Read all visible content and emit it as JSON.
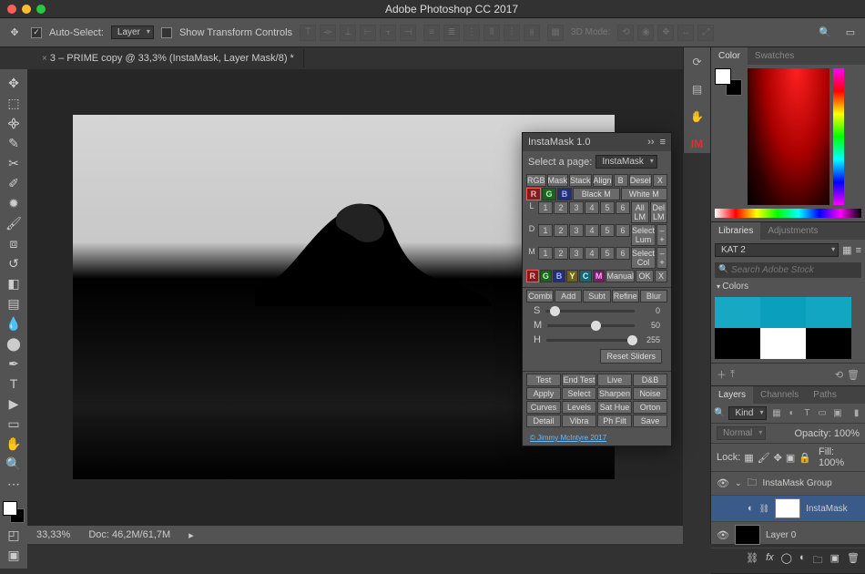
{
  "app_title": "Adobe Photoshop CC 2017",
  "optbar": {
    "auto_select": "Auto-Select:",
    "auto_select_value": "Layer",
    "show_transform": "Show Transform Controls",
    "mode_label": "3D Mode:"
  },
  "doc_tab": "3 – PRIME copy @ 33,3% (InstaMask, Layer Mask/8) *",
  "status": {
    "zoom": "33,33%",
    "doc": "Doc: 46,2M/61,7M"
  },
  "right": {
    "color_tab": "Color",
    "swatches_tab": "Swatches",
    "libraries_tab": "Libraries",
    "adjustments_tab": "Adjustments",
    "lib_name": "KAT 2",
    "search_ph": "Search Adobe Stock",
    "colors_section": "Colors",
    "layers_tab": "Layers",
    "channels_tab": "Channels",
    "paths_tab": "Paths",
    "kind": "Kind",
    "blend": "Normal",
    "opacity_lbl": "Opacity:",
    "opacity_val": "100%",
    "lock_lbl": "Lock:",
    "fill_lbl": "Fill:",
    "fill_val": "100%",
    "group_name": "InstaMask Group",
    "layer_mask_name": "InstaMask",
    "layer0": "Layer 0"
  },
  "swatches": [
    "#17a8c4",
    "#0aa0bd",
    "#13a6c2",
    "#000",
    "#fff",
    "#000"
  ],
  "instamask": {
    "title": "InstaMask 1.0",
    "select_label": "Select a page:",
    "page": "InstaMask",
    "tabs": [
      "RGB",
      "Mask",
      "Stack",
      "Align",
      "B",
      "Desel",
      "X"
    ],
    "chan_row": [
      "R",
      "G",
      "B"
    ],
    "bm": "Black M",
    "wm": "White M",
    "num_rows": [
      [
        "L",
        "1",
        "2",
        "3",
        "4",
        "5",
        "6",
        "All LM",
        "Del LM"
      ],
      [
        "D",
        "1",
        "2",
        "3",
        "4",
        "5",
        "6",
        "Select Lum",
        "– +"
      ],
      [
        "M",
        "1",
        "2",
        "3",
        "4",
        "5",
        "6",
        "Select Col",
        "– +"
      ]
    ],
    "chan_row2": [
      "R",
      "G",
      "B",
      "Y",
      "C",
      "M"
    ],
    "manual": "Manual",
    "ok": "OK",
    "x": "X",
    "ops": [
      "Combi",
      "Add",
      "Subt",
      "Refine",
      "Blur"
    ],
    "sliders": [
      {
        "lbl": "S",
        "val": "0",
        "pos": 5
      },
      {
        "lbl": "M",
        "val": "50",
        "pos": 50
      },
      {
        "lbl": "H",
        "val": "255",
        "pos": 92
      }
    ],
    "reset": "Reset Sliders",
    "actions1": [
      "Test",
      "End Test",
      "Live",
      "D&B"
    ],
    "actions2": [
      "Apply",
      "Select",
      "Sharpen",
      "Noise"
    ],
    "actions3": [
      "Curves",
      "Levels",
      "Sat Hue",
      "Orton"
    ],
    "actions4": [
      "Detail",
      "Vibra",
      "Ph Filt",
      "Save"
    ],
    "credit": "© Jimmy McIntyre 2017"
  }
}
